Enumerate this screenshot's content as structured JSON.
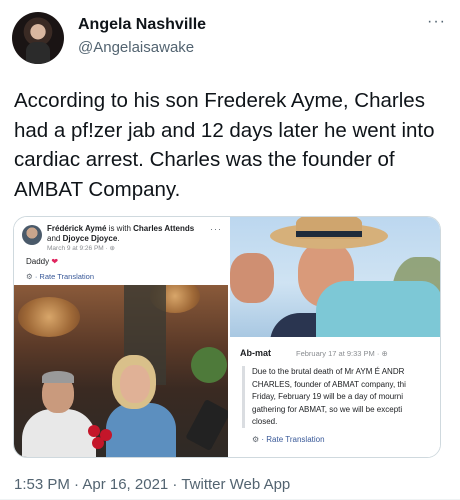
{
  "user": {
    "display_name": "Angela Nashville",
    "handle": "@Angelaisawake"
  },
  "tweet": {
    "text": "According to his son Frederek Ayme, Charles had a pf!zer jab and 12 days later he went into cardiac arrest. Charles was the founder of AMBAT Company.",
    "more_label": "···",
    "footer": "1:53 PM · Apr 16, 2021 · Twitter Web App"
  },
  "media": {
    "left": {
      "author": "Frédérick Aymé",
      "is_with": " is with ",
      "tag1": "Charles Attends",
      "and": " and ",
      "tag2": "Djoyce Djoyce",
      "period": ".",
      "more": "···",
      "date": "March 9 at 9:26 PM · ⊕",
      "caption": "Daddy",
      "heart": "❤",
      "rate_icon": "⚙",
      "rate": " · Rate Translation"
    },
    "right": {
      "author": "Ab-mat",
      "date": "February 17 at 9:33 PM · ⊕",
      "lines": [
        "Due to the brutal death of Mr AYM É ANDR",
        "CHARLES, founder of ABMAT company, thi",
        "Friday, February 19 will be a day of mourni",
        "gathering for ABMAT, so we will be excepti",
        "closed."
      ],
      "rate_icon": "⚙",
      "rate": " · Rate Translation"
    }
  },
  "colors": {
    "text": "#0f1419",
    "secondary": "#536471",
    "border": "#cfd9de",
    "fb_link": "#385898"
  }
}
